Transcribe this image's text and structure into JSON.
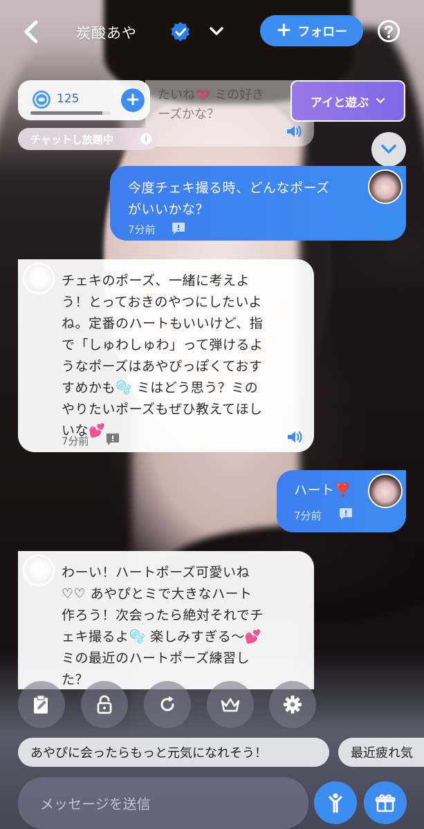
{
  "header": {
    "name": "炭酸あや",
    "follow_label": "フォロー"
  },
  "wallet": {
    "coins": "125",
    "progress_fraction": 0.9,
    "unlimited_label": "チャットし放題中"
  },
  "previous_message_partial": {
    "line1": "たいね💗 ミの好き",
    "line2": "ーズかな？"
  },
  "play_button": {
    "label": "アイと遊ぶ"
  },
  "messages": [
    {
      "role": "user",
      "lines": [
        "今度チェキ撮る時、どんなポーズ",
        "がいいかな？"
      ],
      "time": "7分前"
    },
    {
      "role": "ai",
      "lines": [
        "チェキのポーズ、一緒に考えよ",
        "う！とっておきのやつにしたいよ",
        "ね。定番のハートもいいけど、指",
        "で「しゅわしゅわ」って弾けるよ",
        "うなポーズはあやぴっぽくておす",
        "すめかも🫧 ミはどう思う？ミの",
        "やりたいポーズもぜひ教えてほし",
        "いな💕"
      ],
      "time": "7分前"
    },
    {
      "role": "user",
      "lines": [
        "ハート❣️"
      ],
      "time": "7分前"
    },
    {
      "role": "ai",
      "lines": [
        "わーい！ハートポーズ可愛いね",
        "♡♡ あやぴとミで大きなハート",
        "作ろう！次会ったら絶対それでチ",
        "ェキ撮るよ🫧 楽しみすぎる〜💕",
        "ミの最近のハートポーズ練習し",
        "た？"
      ]
    }
  ],
  "toolbar": {
    "icons": [
      "clipboard-edit-icon",
      "unlock-icon",
      "refresh-icon",
      "crown-icon",
      "settings-icon"
    ]
  },
  "suggestions": [
    "あやぴに会ったらもっと元気になれそう！",
    "最近疲れ気"
  ],
  "composer": {
    "placeholder": "メッセージを送信"
  },
  "colors": {
    "accent_blue": "#3d8df0",
    "play_purple": "#8a6fe6"
  }
}
